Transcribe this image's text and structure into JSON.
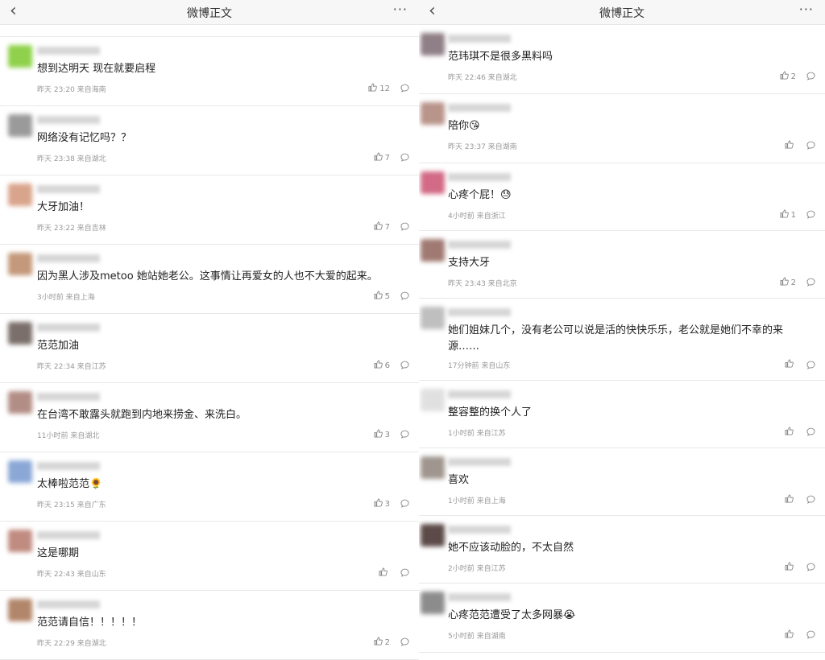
{
  "left": {
    "title": "微博正文",
    "comments": [
      {
        "text": "想到达明天 现在就要启程",
        "meta": "昨天 23:20 来自海南",
        "likes": "12",
        "avatar": "#8fd14a"
      },
      {
        "text": "网络没有记忆吗？？",
        "meta": "昨天 23:38 来自湖北",
        "likes": "7",
        "avatar": "#9a9a9a"
      },
      {
        "text": "大牙加油！",
        "meta": "昨天 23:22 来自吉林",
        "likes": "7",
        "avatar": "#d9a48c"
      },
      {
        "text": "因为黑人涉及metoo 她站她老公。这事情让再爱女的人也不大爱的起来。",
        "meta": "3小时前 来自上海",
        "likes": "5",
        "avatar": "#c4987a"
      },
      {
        "text": "范范加油",
        "meta": "昨天 22:34 来自江苏",
        "likes": "6",
        "avatar": "#7a6f6a"
      },
      {
        "text": "在台湾不敢露头就跑到内地来捞金、来洗白。",
        "meta": "11小时前 来自湖北",
        "likes": "3",
        "avatar": "#b28d86"
      },
      {
        "text": "太棒啦范范🌻",
        "meta": "昨天 23:15 来自广东",
        "likes": "3",
        "avatar": "#8aa7d6"
      },
      {
        "text": "这是哪期",
        "meta": "昨天 22:43 来自山东",
        "likes": "",
        "avatar": "#c08b80"
      },
      {
        "text": "范范请自信！！！！！",
        "meta": "昨天 22:29 来自湖北",
        "likes": "2",
        "avatar": "#b2866a"
      }
    ]
  },
  "right": {
    "title": "微博正文",
    "comments": [
      {
        "text": "范玮琪不是很多黑料吗",
        "meta": "昨天 22:46 来自湖北",
        "likes": "2",
        "avatar": "#8f7f86"
      },
      {
        "text": "陪你😘",
        "meta": "昨天 23:37 来自湖南",
        "likes": "",
        "avatar": "#b8948a"
      },
      {
        "text": "心疼个屁！😓",
        "meta": "4小时前 来自浙江",
        "likes": "1",
        "avatar": "#d26a86"
      },
      {
        "text": "支持大牙",
        "meta": "昨天 23:43 来自北京",
        "likes": "2",
        "avatar": "#a07a72"
      },
      {
        "text": "她们姐妹几个，没有老公可以说是活的快快乐乐，老公就是她们不幸的来源……",
        "meta": "17分钟前 来自山东",
        "likes": "",
        "avatar": "#bfbfbf"
      },
      {
        "text": "整容整的换个人了",
        "meta": "1小时前 来自江苏",
        "likes": "",
        "avatar": "#e0e0e0"
      },
      {
        "text": "喜欢",
        "meta": "1小时前 来自上海",
        "likes": "",
        "avatar": "#a0968f"
      },
      {
        "text": "她不应该动脸的，不太自然",
        "meta": "2小时前 来自江苏",
        "likes": "",
        "avatar": "#5c4a48"
      },
      {
        "text": "心疼范范遭受了太多网暴😭",
        "meta": "5小时前 来自湖南",
        "likes": "",
        "avatar": "#8c8c8c"
      }
    ]
  },
  "icons": {
    "back": "chevron-left-icon",
    "more": "more-dots-icon",
    "like": "thumbs-up-icon",
    "comment": "comment-bubble-icon"
  }
}
